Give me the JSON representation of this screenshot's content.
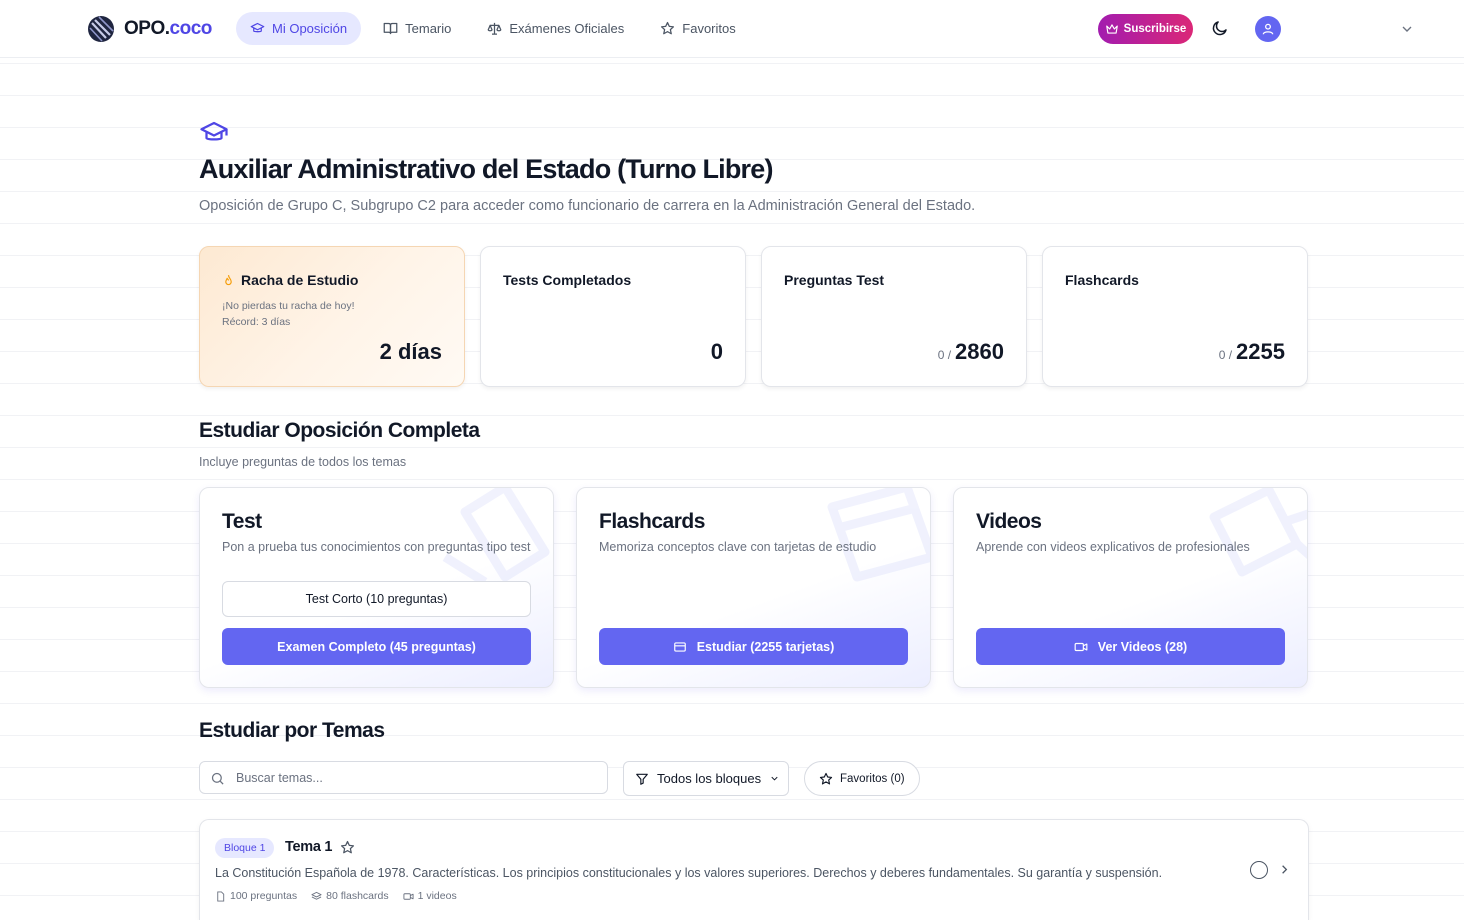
{
  "header": {
    "logo_text_a": "OPO.",
    "logo_text_b": "coco",
    "nav": [
      {
        "label": "Mi Oposición",
        "icon": "graduation-cap-icon"
      },
      {
        "label": "Temario",
        "icon": "book-icon"
      },
      {
        "label": "Exámenes Oficiales",
        "icon": "scale-icon"
      },
      {
        "label": "Favoritos",
        "icon": "star-icon"
      }
    ],
    "subscribe_label": "Suscribirse",
    "colors": {
      "accent": "#4f46e5",
      "subscribe_from": "#a21caf",
      "subscribe_to": "#db2777"
    }
  },
  "hero": {
    "title": "Auxiliar Administrativo del Estado (Turno Libre)",
    "subtitle": "Oposición de Grupo C, Subgrupo C2 para acceder como funcionario de carrera en la Administración General del Estado."
  },
  "stats": {
    "streak": {
      "title": "Racha de Estudio",
      "note1": "¡No pierdas tu racha de hoy!",
      "note2": "Récord: 3 días",
      "value": "2 días"
    },
    "tests": {
      "title": "Tests Completados",
      "value": "0"
    },
    "questions": {
      "title": "Preguntas Test",
      "prefix": "0 /",
      "value": "2860"
    },
    "flashcards": {
      "title": "Flashcards",
      "prefix": "0 /",
      "value": "2255"
    }
  },
  "full": {
    "title": "Estudiar Oposición Completa",
    "subtitle": "Incluye preguntas de todos los temas",
    "cards": {
      "test": {
        "title": "Test",
        "desc": "Pon a prueba tus conocimientos con preguntas tipo test",
        "btn_outline": "Test Corto (10 preguntas)",
        "btn_primary": "Examen Completo (45 preguntas)"
      },
      "flash": {
        "title": "Flashcards",
        "desc": "Memoriza conceptos clave con tarjetas de estudio",
        "btn_primary": "Estudiar (2255 tarjetas)"
      },
      "videos": {
        "title": "Videos",
        "desc": "Aprende con videos explicativos de profesionales",
        "btn_primary": "Ver Videos (28)"
      }
    }
  },
  "topics": {
    "title": "Estudiar por Temas",
    "search_placeholder": "Buscar temas...",
    "filter_blocks": "Todos los bloques",
    "filter_favs": "Favoritos (0)",
    "items": [
      {
        "badge": "Bloque 1",
        "title": "Tema 1",
        "desc": "La Constitución Española de 1978. Características. Los principios constitucionales y los valores superiores. Derechos y deberes fundamentales. Su garantía y suspensión.",
        "questions": "100 preguntas",
        "flashcards": "80 flashcards",
        "videos": "1 videos"
      }
    ]
  }
}
